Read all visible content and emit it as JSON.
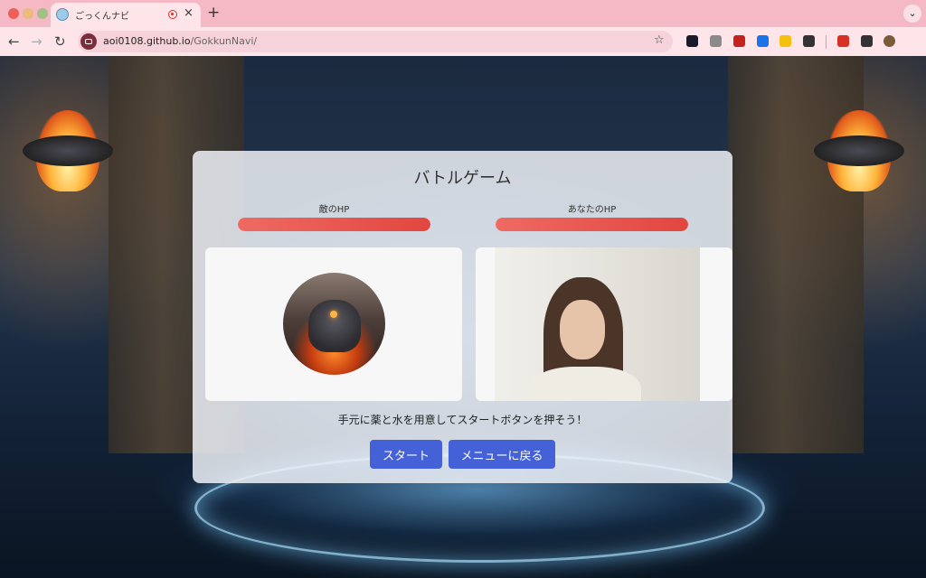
{
  "browser": {
    "tab_title": "ごっくんナビ",
    "tab_close": "×",
    "new_tab": "+",
    "tab_menu": "⌄",
    "back": "←",
    "forward": "→",
    "reload": "↻",
    "url_domain": "aoi0108.github.io",
    "url_path": "/GokkunNavi/",
    "bookmark": "☆",
    "extension_colors": [
      "#1a1a2e",
      "#8a8a8a",
      "#c5221f",
      "#1a73e8",
      "#f4c20d",
      "#333333",
      "#d93025",
      "#333333",
      "#7a5b3a"
    ]
  },
  "game": {
    "title": "バトルゲーム",
    "enemy_hp_label": "敵のHP",
    "player_hp_label": "あなたのHP",
    "enemy_hp_fraction": 1.0,
    "player_hp_fraction": 1.0,
    "instruction": "手元に薬と水を用意してスタートボタンを押そう！",
    "start_button": "スタート",
    "menu_button": "メニューに戻る",
    "accent_color": "#4461d8",
    "hp_color": "#e2463f"
  }
}
